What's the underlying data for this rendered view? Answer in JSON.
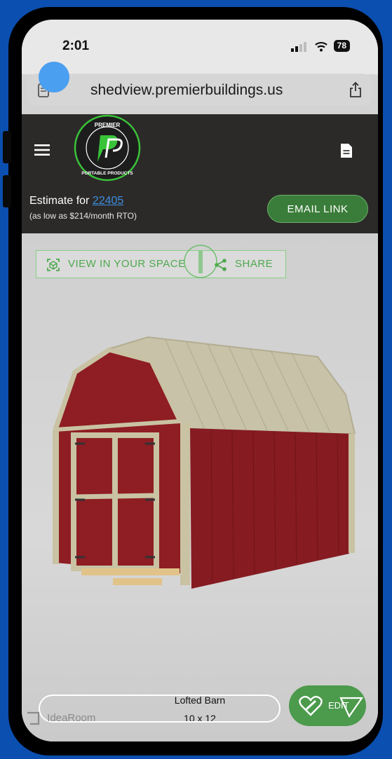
{
  "status_bar": {
    "time": "2:01",
    "battery": "78"
  },
  "browser": {
    "url": "shedview.premierbuildings.us"
  },
  "header": {
    "logo_text_top": "PREMIER",
    "logo_text_bottom": "PORTABLE PRODUCTS"
  },
  "estimate": {
    "prefix": "Estimate for ",
    "zip": "22405",
    "financing": "(as low as $214/month RTO)",
    "email_button": "EMAIL LINK"
  },
  "viewer": {
    "view_in_space": "VIEW IN YOUR SPACE",
    "share": "SHARE",
    "product_name": "Lofted Barn",
    "product_size": "10 x 12",
    "watermark": "IdeaRoom",
    "edit_button": "EDIT"
  },
  "colors": {
    "accent_green": "#3a7d3a",
    "header_bg": "#2c2a28",
    "shed_red": "#8e1d24",
    "shed_trim": "#c9c2a3"
  }
}
